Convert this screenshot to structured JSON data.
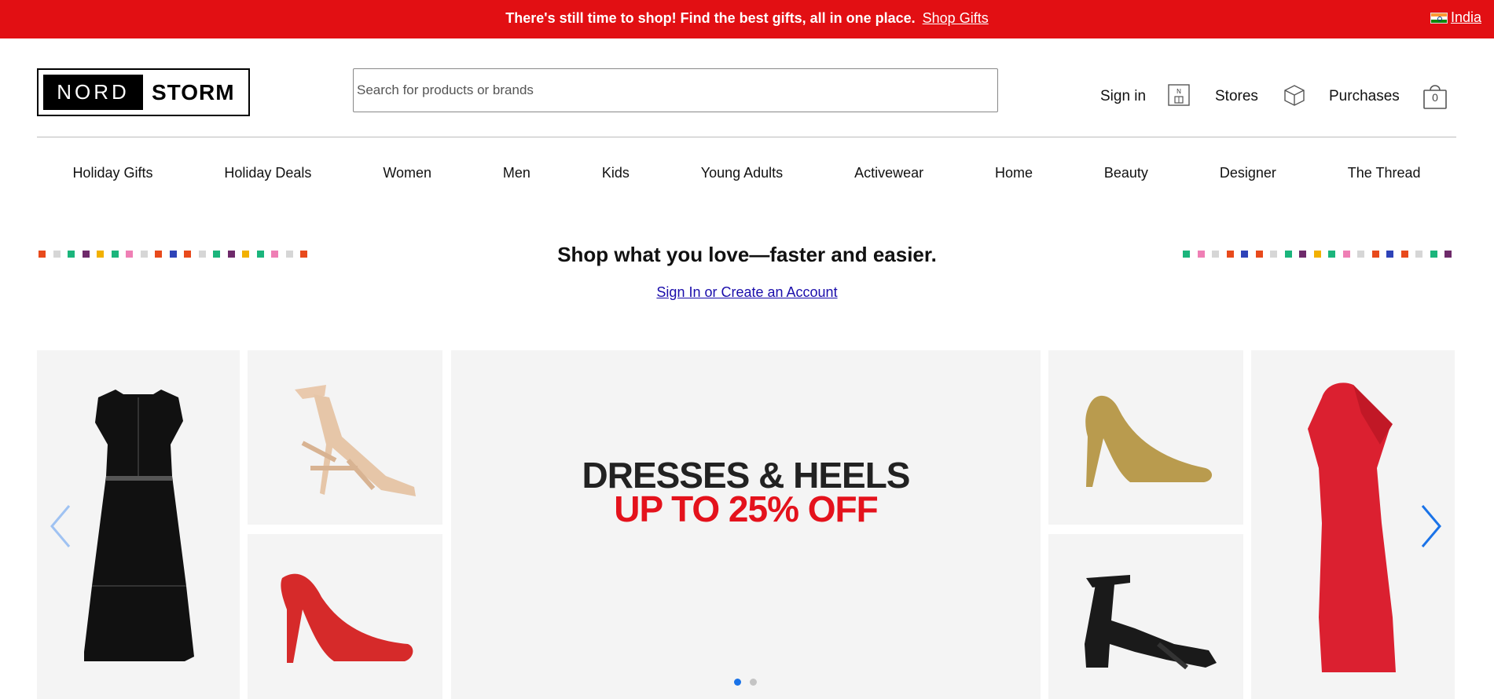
{
  "promo": {
    "text": "There's still time to shop! Find the best gifts, all in one place.",
    "link": "Shop Gifts",
    "country": "India"
  },
  "logo": {
    "left": "NORD",
    "right": "STORM"
  },
  "search": {
    "placeholder": "Search for products or brands",
    "value": ""
  },
  "account": {
    "signin": "Sign in",
    "stores": "Stores",
    "purchases": "Purchases",
    "bag_count": "0"
  },
  "nav": {
    "items": [
      "Holiday Gifts",
      "Holiday Deals",
      "Women",
      "Men",
      "Kids",
      "Young Adults",
      "Activewear",
      "Home",
      "Beauty",
      "Designer",
      "The Thread"
    ]
  },
  "hero": {
    "headline": "Shop what you love—faster and easier.",
    "link": "Sign In or Create an Account",
    "dot_colors_left": [
      "#e84a1c",
      "#d6d6d6",
      "#1bb57c",
      "#6e2a6a",
      "#f2b100",
      "#1bb57c",
      "#ef7fb5",
      "#d6d6d6",
      "#e84a1c",
      "#2e43b8",
      "#e84a1c",
      "#d6d6d6",
      "#1bb57c",
      "#6e2a6a",
      "#f2b100",
      "#1bb57c",
      "#ef7fb5",
      "#d6d6d6",
      "#e84a1c"
    ],
    "dot_colors_right": [
      "#1bb57c",
      "#ef7fb5",
      "#d6d6d6",
      "#e84a1c",
      "#2e43b8",
      "#e84a1c",
      "#d6d6d6",
      "#1bb57c",
      "#6e2a6a",
      "#f2b100",
      "#1bb57c",
      "#ef7fb5",
      "#d6d6d6",
      "#e84a1c",
      "#2e43b8",
      "#e84a1c",
      "#d6d6d6",
      "#1bb57c",
      "#6e2a6a"
    ]
  },
  "carousel": {
    "banner_line1": "DRESSES & HEELS",
    "banner_line2": "UP TO 25% OFF",
    "slides": 2,
    "active_slide": 1,
    "accent_color": "#1a73e8",
    "sale_color": "#e4121c"
  },
  "colors": {
    "promo_bg": "#e20f13",
    "link": "#1a0dab"
  }
}
